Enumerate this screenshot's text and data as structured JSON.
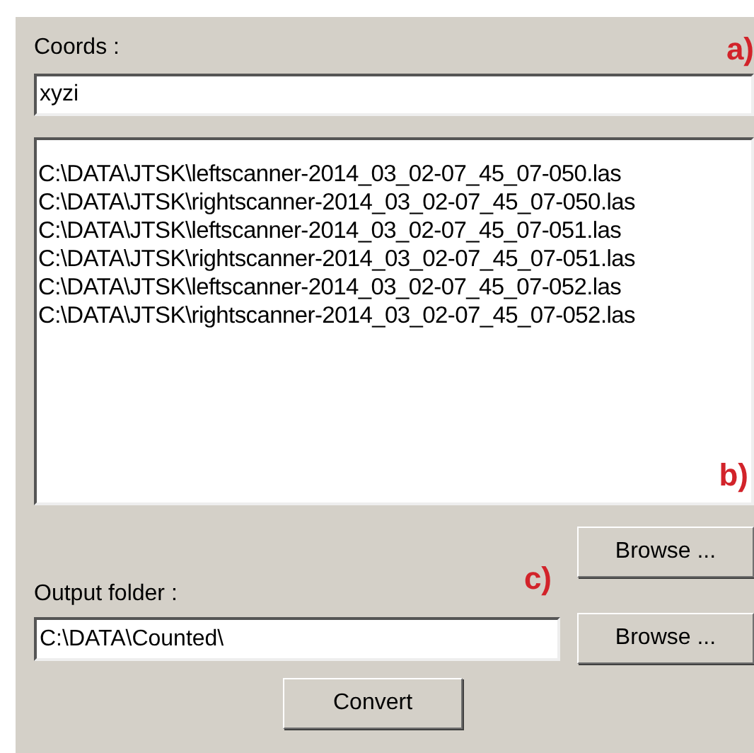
{
  "coords": {
    "label": "Coords :",
    "value": "xyzi",
    "annotation": "a)"
  },
  "files": {
    "items": [
      "C:\\DATA\\JTSK\\leftscanner-2014_03_02-07_45_07-050.las",
      "C:\\DATA\\JTSK\\rightscanner-2014_03_02-07_45_07-050.las",
      "C:\\DATA\\JTSK\\leftscanner-2014_03_02-07_45_07-051.las",
      "C:\\DATA\\JTSK\\rightscanner-2014_03_02-07_45_07-051.las",
      "C:\\DATA\\JTSK\\leftscanner-2014_03_02-07_45_07-052.las",
      "C:\\DATA\\JTSK\\rightscanner-2014_03_02-07_45_07-052.las"
    ],
    "annotation": "b)",
    "browse": "Browse ..."
  },
  "output": {
    "label": "Output folder :",
    "value": "C:\\DATA\\Counted\\",
    "annotation": "c)",
    "browse": "Browse ..."
  },
  "convert": "Convert"
}
